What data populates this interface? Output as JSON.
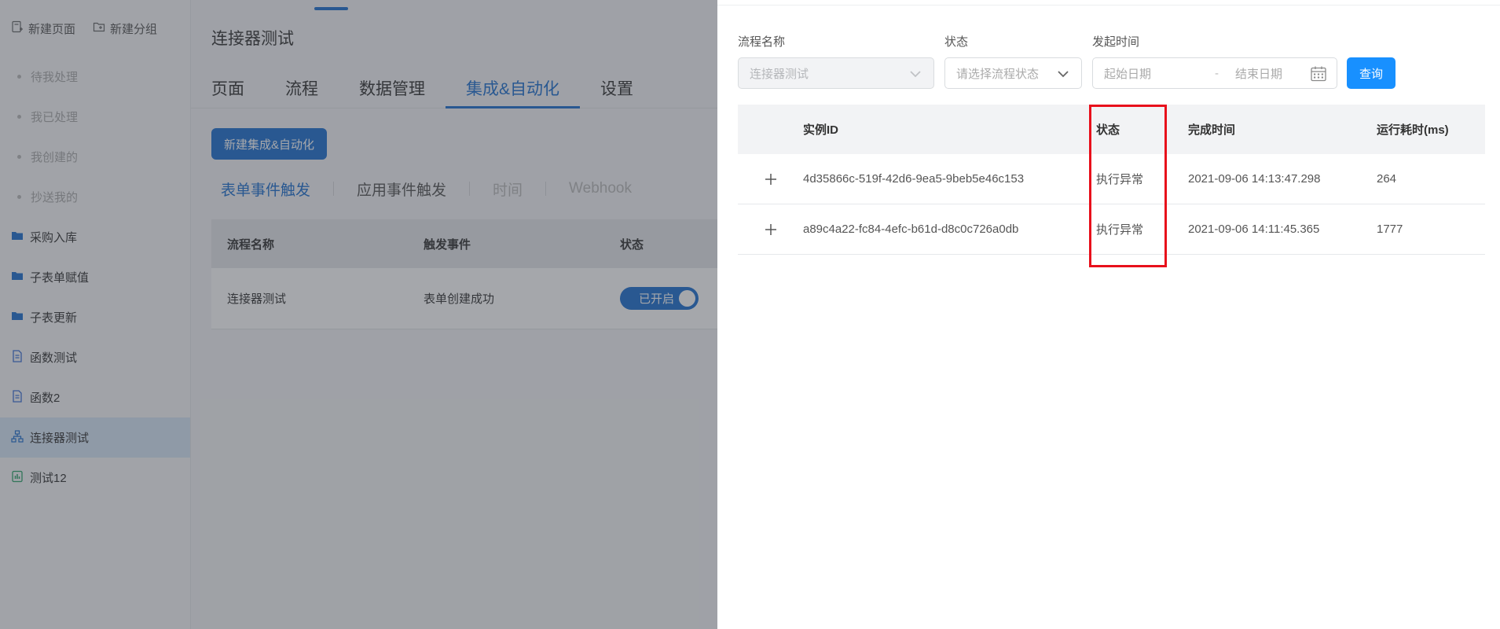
{
  "sidebar": {
    "top_buttons": [
      {
        "label": "新建页面",
        "icon": "new-page-icon"
      },
      {
        "label": "新建分组",
        "icon": "new-folder-icon"
      }
    ],
    "sub_items": [
      {
        "label": "待我处理"
      },
      {
        "label": "我已处理"
      },
      {
        "label": "我创建的"
      },
      {
        "label": "抄送我的"
      }
    ],
    "items": [
      {
        "label": "采购入库",
        "icon": "folder-icon"
      },
      {
        "label": "子表单赋值",
        "icon": "folder-icon"
      },
      {
        "label": "子表更新",
        "icon": "folder-icon"
      },
      {
        "label": "函数测试",
        "icon": "form-doc-icon"
      },
      {
        "label": "函数2",
        "icon": "form-doc-icon"
      },
      {
        "label": "连接器测试",
        "icon": "flow-icon",
        "active": true
      },
      {
        "label": "测试12",
        "icon": "report-icon"
      }
    ]
  },
  "main": {
    "title": "连接器测试",
    "tabs": [
      {
        "label": "页面"
      },
      {
        "label": "流程"
      },
      {
        "label": "数据管理"
      },
      {
        "label": "集成&自动化",
        "active": true
      },
      {
        "label": "设置"
      }
    ],
    "new_button": "新建集成&自动化",
    "subtabs": [
      {
        "label": "表单事件触发",
        "state": "active"
      },
      {
        "label": "应用事件触发",
        "state": "normal"
      },
      {
        "label": "时间",
        "state": "disabled"
      },
      {
        "label": "Webhook",
        "state": "disabled"
      }
    ],
    "table": {
      "headers": [
        "流程名称",
        "触发事件",
        "状态"
      ],
      "rows": [
        {
          "name": "连接器测试",
          "event": "表单创建成功",
          "status": "已开启"
        }
      ]
    }
  },
  "drawer": {
    "filters": {
      "flow_name": {
        "label": "流程名称",
        "value": "连接器测试"
      },
      "status": {
        "label": "状态",
        "placeholder": "请选择流程状态"
      },
      "start_time": {
        "label": "发起时间",
        "start_placeholder": "起始日期",
        "separator": "-",
        "end_placeholder": "结束日期"
      },
      "query_button": "查询"
    },
    "table": {
      "headers": {
        "id": "实例ID",
        "status": "状态",
        "finish_time": "完成时间",
        "duration": "运行耗时(ms)"
      },
      "rows": [
        {
          "id": "4d35866c-519f-42d6-9ea5-9beb5e46c153",
          "status": "执行异常",
          "finish_time": "2021-09-06 14:13:47.298",
          "duration": "264"
        },
        {
          "id": "a89c4a22-fc84-4efc-b61d-d8c0c726a0db",
          "status": "执行异常",
          "finish_time": "2021-09-06 14:11:45.365",
          "duration": "1777"
        }
      ]
    }
  },
  "colors": {
    "accent": "#1e6fcf",
    "query_button": "#1890ff",
    "highlight": "#e8101b"
  }
}
